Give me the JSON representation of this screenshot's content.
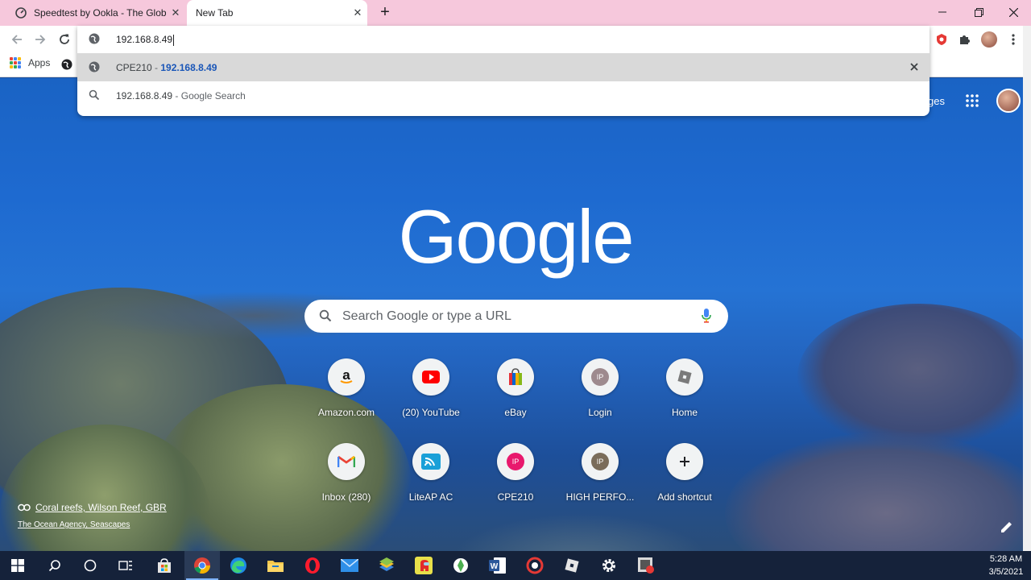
{
  "browser": {
    "tabs": [
      {
        "title": "Speedtest by Ookla - The Global",
        "active": false
      },
      {
        "title": "New Tab",
        "active": true
      }
    ],
    "new_tab": "+",
    "address_value": "192.168.8.49",
    "bookmarks": {
      "apps_label": "Apps"
    }
  },
  "omnibox": {
    "suggestions": [
      {
        "title": "CPE210",
        "separator": " - ",
        "url": "192.168.8.49",
        "icon": "globe-icon",
        "selected": true
      },
      {
        "title": "192.168.8.49",
        "separator": " - ",
        "hint": "Google Search",
        "icon": "search-icon",
        "selected": false
      }
    ]
  },
  "ntp": {
    "logo": "Google",
    "search_placeholder": "Search Google or type a URL",
    "images_partial": "ges",
    "shortcuts": [
      {
        "label": "Amazon.com",
        "icon": "amazon-icon"
      },
      {
        "label": "(20) YouTube",
        "icon": "youtube-icon"
      },
      {
        "label": "eBay",
        "icon": "shopping-bag-icon"
      },
      {
        "label": "Login",
        "icon": "ip-badge-icon",
        "badge": "IP",
        "color": "#9e8a8e"
      },
      {
        "label": "Home",
        "icon": "roblox-icon"
      },
      {
        "label": "Inbox (280)",
        "icon": "gmail-icon"
      },
      {
        "label": "LiteAP AC",
        "icon": "wireless-icon"
      },
      {
        "label": "CPE210",
        "icon": "ip-badge-icon",
        "badge": "IP",
        "color": "#e8196d"
      },
      {
        "label": "HIGH PERFO...",
        "icon": "ip-badge-icon",
        "badge": "IP",
        "color": "#7a6c5a"
      },
      {
        "label": "Add shortcut",
        "icon": "plus-icon"
      }
    ],
    "attribution": {
      "title": "Coral reefs, Wilson Reef, GBR",
      "credit": "The Ocean Agency, Seascapes"
    }
  },
  "taskbar": {
    "time": "5:28 AM",
    "date": "3/5/2021"
  },
  "colors": {
    "tabstrip": "#f6c8dc",
    "url_blue": "#1a56b8",
    "taskbar": "#15223a"
  }
}
